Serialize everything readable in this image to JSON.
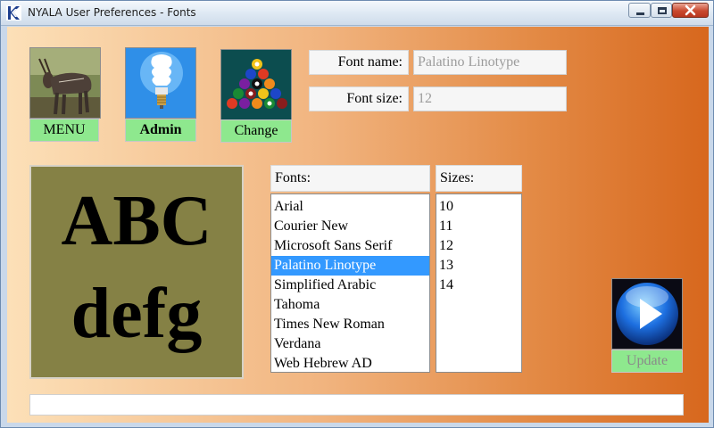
{
  "window": {
    "title": "NYALA User Preferences - Fonts"
  },
  "toolbar": {
    "menu_label": "MENU",
    "admin_label": "Admin",
    "change_label": "Change"
  },
  "font_settings": {
    "font_name_label": "Font name:",
    "font_name_value": "Palatino Linotype",
    "font_size_label": "Font size:",
    "font_size_value": "12"
  },
  "preview": {
    "line1": "ABC",
    "line2": "defg"
  },
  "fonts": {
    "header": "Fonts:",
    "items": [
      "Arial",
      "Courier New",
      "Microsoft Sans Serif",
      "Palatino Linotype",
      "Simplified Arabic",
      "Tahoma",
      "Times New Roman",
      "Verdana",
      "Web Hebrew AD"
    ],
    "selected": "Palatino Linotype"
  },
  "sizes": {
    "header": "Sizes:",
    "items": [
      "10",
      "11",
      "12",
      "13",
      "14"
    ]
  },
  "update": {
    "label": "Update"
  },
  "status": {
    "text": ""
  },
  "colors": {
    "button_green": "#8ee88e",
    "selection_blue": "#3399ff",
    "preview_bg": "#858145"
  }
}
